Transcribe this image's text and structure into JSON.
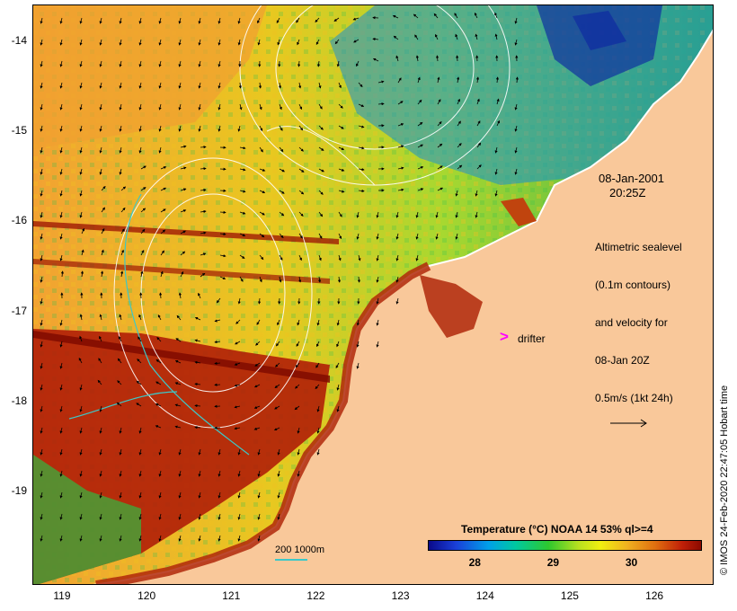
{
  "map": {
    "lon_ticks": [
      "119",
      "120",
      "121",
      "122",
      "123",
      "124",
      "125",
      "126"
    ],
    "lat_ticks": [
      "-14",
      "-15",
      "-16",
      "-17",
      "-18",
      "-19"
    ],
    "lon_range": [
      118.65,
      126.7
    ],
    "lat_range": [
      -13.6,
      -20.05
    ],
    "land_color": "#f9c89a",
    "contour_color": "#ffffff",
    "isobath_color": "#3cc8c8"
  },
  "annotations": {
    "date": "08-Jan-2001",
    "time": "20:25Z",
    "legend_lines": [
      "Altimetric sealevel",
      "(0.1m contours)",
      "and velocity for",
      "08-Jan 20Z",
      "0.5m/s (1kt 24h)"
    ],
    "drifter_label": "drifter",
    "drifter_symbol": ">",
    "drifter_color": "#ff00ff",
    "scale_label": "200  1000m"
  },
  "colorbar": {
    "title": "Temperature (°C) NOAA 14 53% ql>=4",
    "ticks": [
      "28",
      "29",
      "30"
    ],
    "tick_values": [
      28,
      29,
      30
    ],
    "range": [
      27.4,
      30.9
    ]
  },
  "credit": "© IMOS 24-Feb-2020 22:47:05 Hobart time"
}
